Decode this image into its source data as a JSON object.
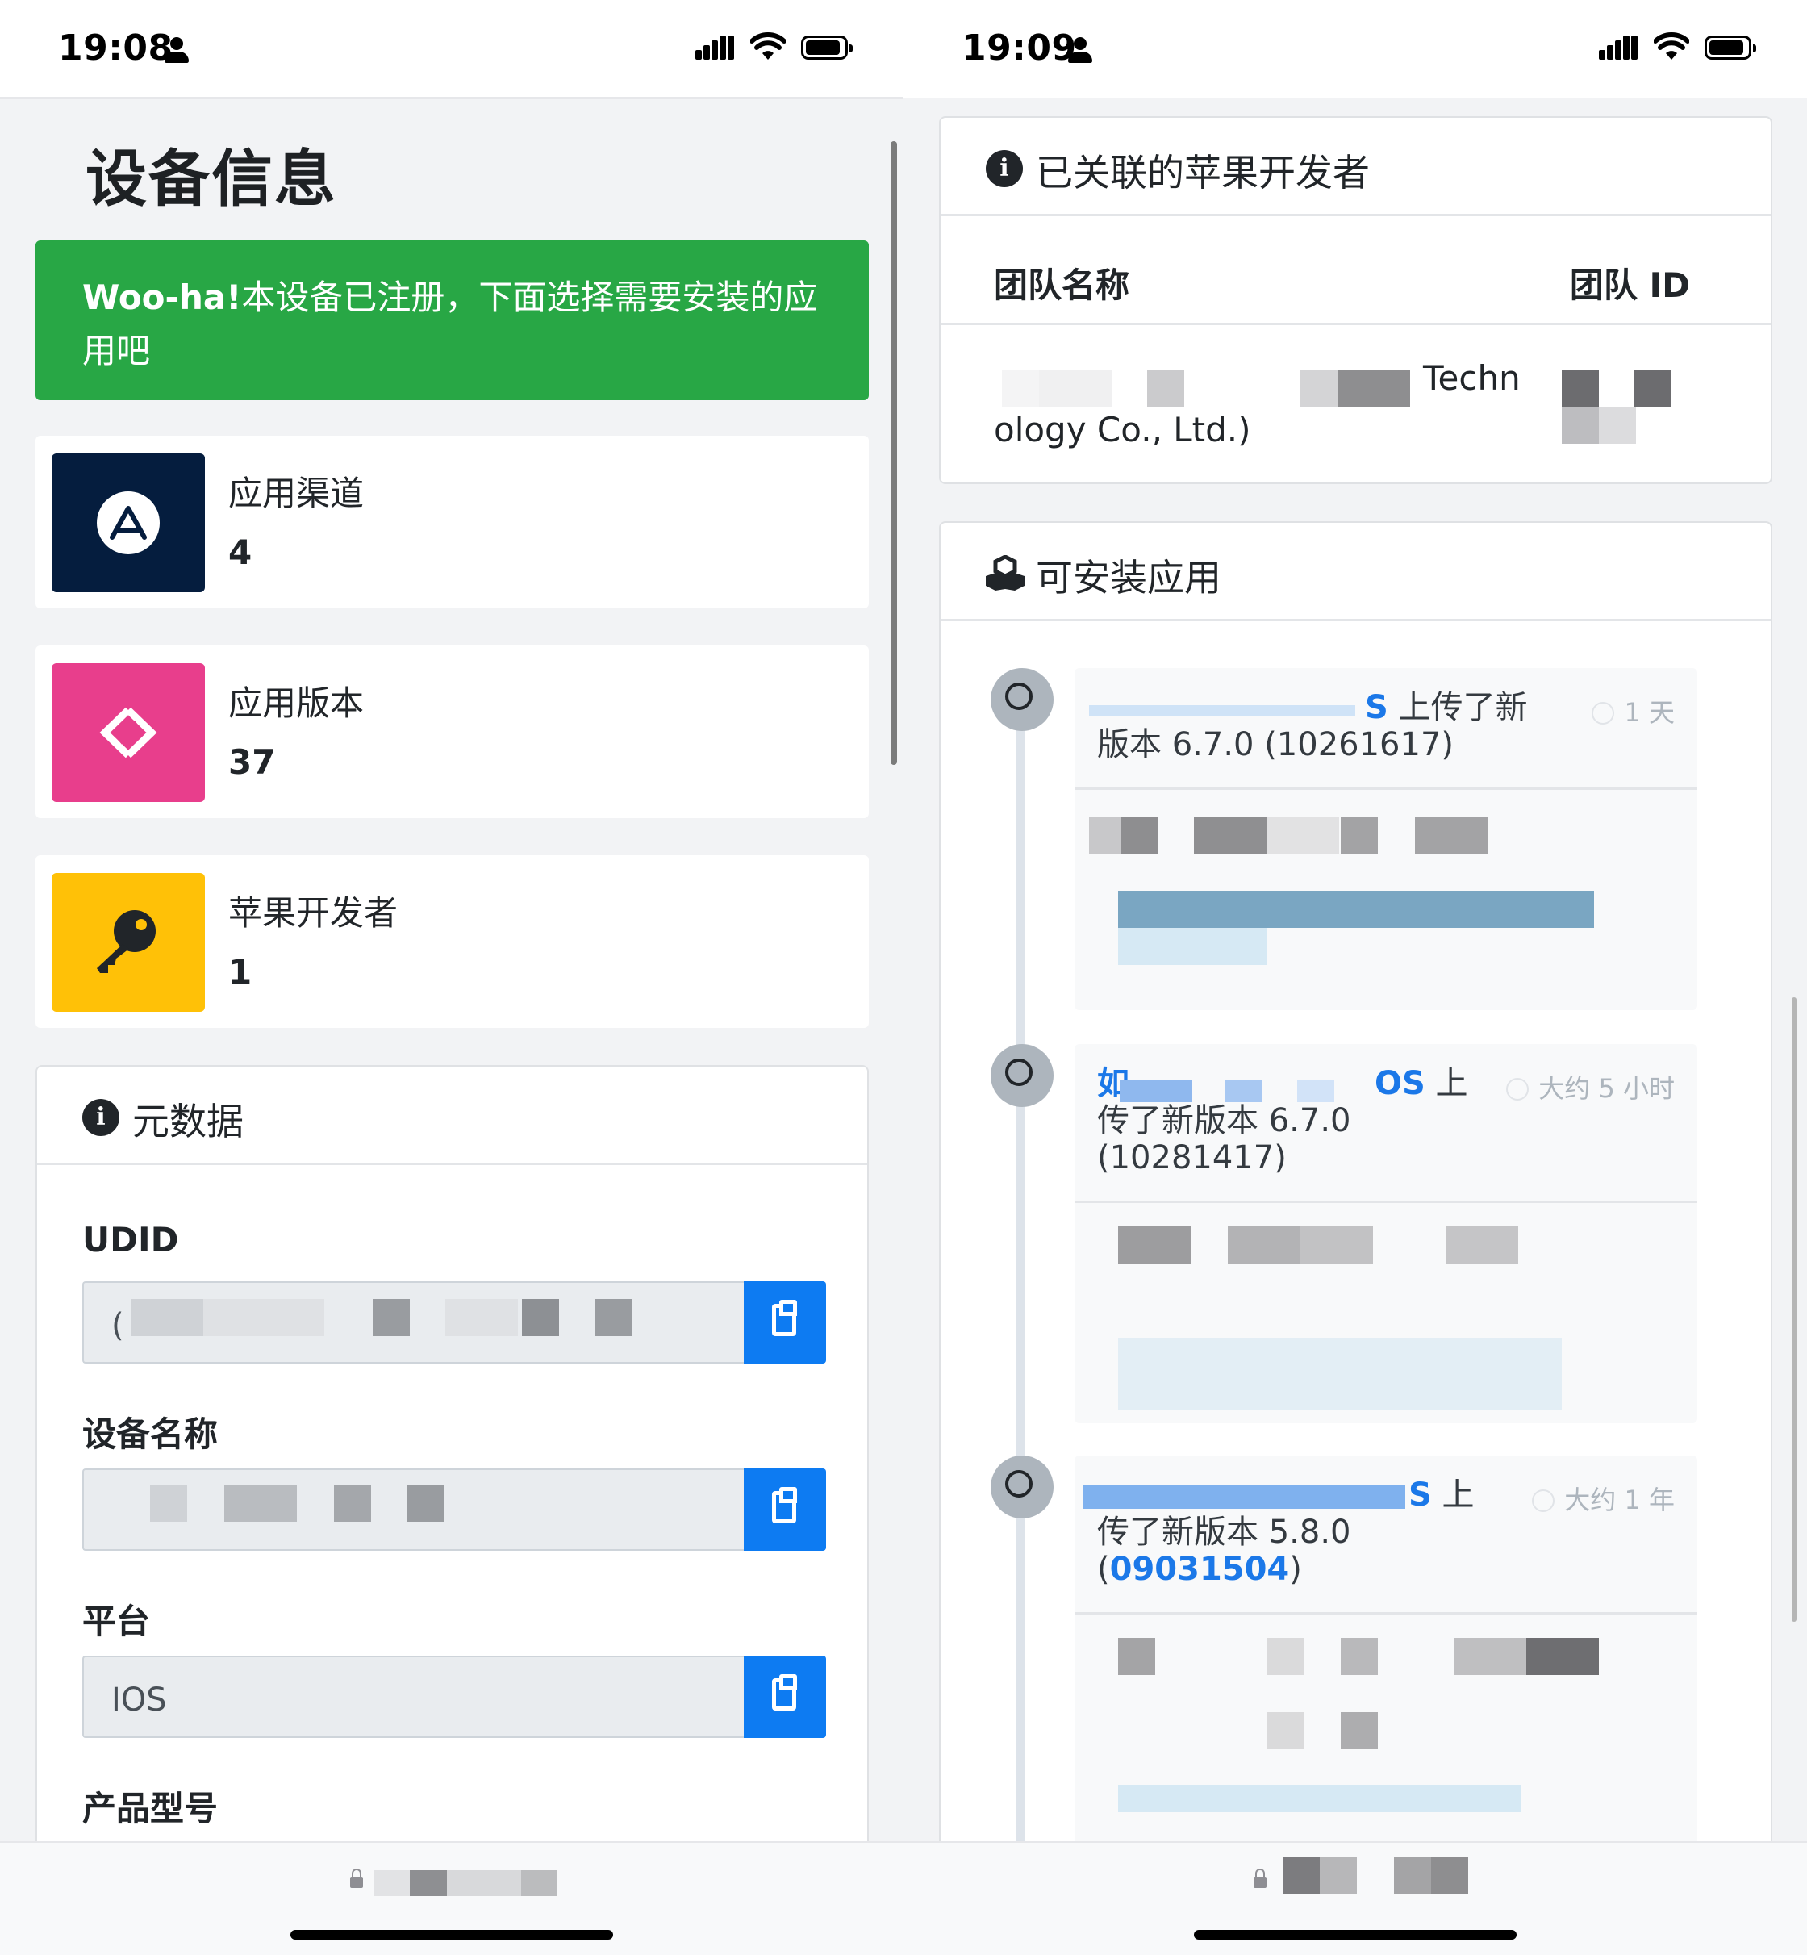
{
  "left": {
    "status": {
      "time": "19:08"
    },
    "page_title": "设备信息",
    "alert": {
      "strong": "Woo-ha!",
      "text": "本设备已注册，下面选择需要安装的应用吧"
    },
    "stats": [
      {
        "label": "应用渠道",
        "value": "4",
        "icon": "app-store-icon",
        "color": "#051d3e"
      },
      {
        "label": "应用版本",
        "value": "37",
        "icon": "code-diamond-icon",
        "color": "#e83e8c"
      },
      {
        "label": "苹果开发者",
        "value": "1",
        "icon": "key-icon",
        "color": "#ffc107"
      }
    ],
    "metadata": {
      "title": "元数据",
      "fields": [
        {
          "label": "UDID",
          "value": "("
        },
        {
          "label": "设备名称",
          "value": ""
        },
        {
          "label": "平台",
          "value": "IOS"
        },
        {
          "label": "产品型号",
          "value": ""
        }
      ]
    }
  },
  "right": {
    "status": {
      "time": "19:09"
    },
    "developers": {
      "title": "已关联的苹果开发者",
      "col_name": "团队名称",
      "col_id": "团队 ID",
      "row_name_part1": "Techn",
      "row_name_part2": "ology Co., Ltd.)"
    },
    "apps": {
      "title": "可安装应用",
      "items": [
        {
          "title_tail": "S",
          "title_rest": " 上传了新",
          "line2": "版本 6.7.0 (10261617)",
          "line3": "",
          "time": "1 天"
        },
        {
          "title_head": "如",
          "title_tail": "OS",
          "title_rest": " 上",
          "line2": "传了新版本 6.7.0",
          "line3": "(10281417)",
          "time": "大约 5 小时"
        },
        {
          "title_tail": "S",
          "title_rest": " 上",
          "line2": "传了新版本 5.8.0",
          "line3_open": "(",
          "line3_link": "09031504",
          "line3_close": ")",
          "time": "大约 1 年"
        }
      ]
    }
  }
}
